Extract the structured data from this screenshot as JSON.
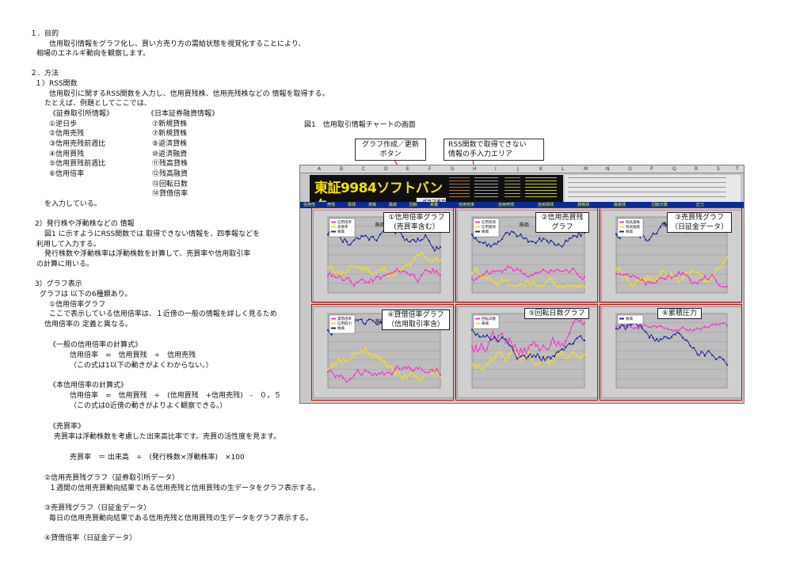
{
  "doc": {
    "lines": [
      "１．目的",
      "信用取引情報をグラフ化し、買い方売り方の需給状態を視覚化することにより、",
      "相場のエネルギ動向を観察します。",
      "２．方法",
      "１）RSS関数",
      "信用取引に関するRSS関数を入力し、信用買残株、信用売残株などの 情報を取得する。",
      "たとえば、例題としてここでは、",
      "《証券取引所情報》",
      "《日本証券融資情報》",
      "①逆日歩",
      "⑦新規貸株",
      "②信用売残",
      "⑦新規貸株",
      "③信用売残前週比",
      "⑨返済貸株",
      "④信用買残",
      "⑩返済融資",
      "⑤信用買残前週比",
      "⑪残高貸株",
      "⑥信用倍率",
      "⑫残高融資",
      "⑬回転日数",
      "⑭貸借倍率",
      "を入力している。",
      "2）発行株や浮動株などの 情報",
      "図1 に示すようにRSS関数では 取得できない情報を、四季報などを",
      "利用して入力する。",
      "発行株数や浮動株率は浮動株数を計算して、売買率や信用取引率",
      "の計算に用いる。",
      "3）グラフ表示",
      "グラフは 以下の6種類あり。",
      "①信用倍率グラフ",
      "ここで表示している信用倍率は、１近傍の一般の情報を詳しく見るため",
      "信用倍率の 定義と異なる。",
      "《一般の信用倍率の計算式》",
      "信用倍率　=　信用買残　÷　信用売残",
      "（この式は1以下の動きがよくわからない。）",
      "《本信用倍率の計算式》",
      "信用倍率　=　信用買残　÷　(信用買残　+信用売残)　-　０，５",
      "（この式は0近傍の動きがよりよく観察できる。）",
      "《売買率》",
      "売買率は浮動株数を考慮した出来高比率です。売買の活性度を見ます。",
      "売買率　＝ 出来高　÷　(発行株数×浮動株率)　×100",
      "②信用売買残グラフ（証券取引所データ）",
      "１週間の信用売買動向結果である信用売残と信用買残の生データをグラフ表示する。",
      "③売買残グラフ（日証金データ）",
      "毎日の信用売買動向結果である信用売残と信用買残の生データをグラフ表示する。",
      "④貸借倍率（日証金データ）"
    ]
  },
  "figure": {
    "caption": "図1　信用取引情報チャートの画面",
    "callout_graph_btn": [
      "グラフ作成／更新",
      "ボタン"
    ],
    "callout_rss": [
      "RSS関数で取得できない",
      "情報の手入力エリア"
    ],
    "banner": "東証9984ソフトバンク",
    "graph_button": "グラフ表示",
    "columns": [
      "A",
      "B",
      "C",
      "D",
      "E",
      "F",
      "G",
      "H",
      "I",
      "J",
      "K",
      "L",
      "M",
      "N",
      "O",
      "P",
      "Q",
      "R",
      "S",
      "T"
    ],
    "menu": [
      "信用倍",
      "売残",
      "買残",
      "貸株",
      "融資",
      "回転",
      "累積",
      "信用倍率",
      "信用売残",
      "信用買残",
      "貸株残",
      "融資残",
      "回転日数",
      "圧力"
    ],
    "panels": [
      {
        "caption": [
          "①信用倍率グラフ",
          "(売買率含む）"
        ],
        "legend": [
          "信用倍率",
          "売買率",
          "株価"
        ],
        "label": "株価"
      },
      {
        "caption": [
          "②信用売買残",
          "グラフ"
        ],
        "legend": [
          "信用売残",
          "信用買残",
          "株価"
        ],
        "label": "株価"
      },
      {
        "caption": [
          "③売買残グラフ",
          "（日証金データ）"
        ],
        "legend": [
          "残高貸株",
          "残高融資",
          "株価"
        ],
        "label": "株価"
      },
      {
        "caption": [
          "④貸借倍率グラフ",
          "（信用取引率含）"
        ],
        "legend": [
          "貸借倍率",
          "信用取引",
          "株価"
        ],
        "label": "株価"
      },
      {
        "caption": [
          "⑤回転日数グラフ"
        ],
        "legend": [
          "回転日数",
          "株価"
        ],
        "label": ""
      },
      {
        "caption": [
          "⑥累積圧力"
        ],
        "legend": [
          "株価"
        ],
        "label": ""
      }
    ],
    "colors": {
      "price": "#1a2aa0",
      "yellow": "#ffe100",
      "magenta": "#ff2fd0",
      "red_box": "#e00000",
      "panel_bg": "#cfcfcf"
    }
  }
}
